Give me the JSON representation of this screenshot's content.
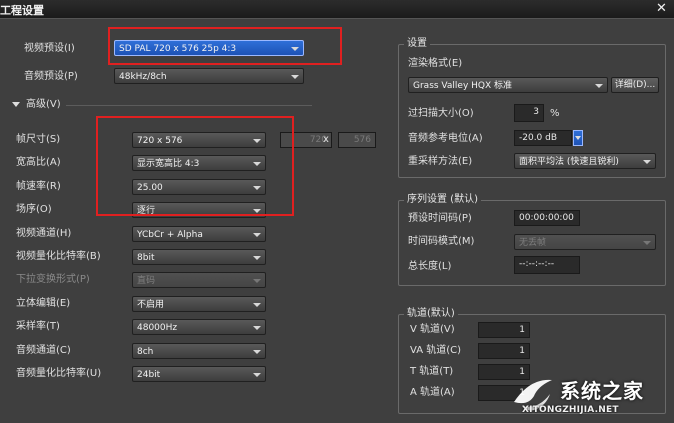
{
  "window": {
    "title": "工程设置",
    "close_glyph": "✕"
  },
  "left": {
    "video_preset": {
      "label": "视频预设(I)",
      "value": "SD PAL 720 x 576 25p 4:3"
    },
    "audio_preset": {
      "label": "音频预设(P)",
      "value": "48kHz/8ch"
    },
    "advanced_label": "高级(V)",
    "rows": [
      {
        "label": "帧尺寸(S)",
        "value": "720 x 576",
        "disabled": false
      },
      {
        "label": "宽高比(A)",
        "value": "显示宽高比 4:3",
        "disabled": false
      },
      {
        "label": "帧速率(R)",
        "value": "25.00",
        "disabled": false
      },
      {
        "label": "场序(O)",
        "value": "逐行",
        "disabled": false
      },
      {
        "label": "视频通道(H)",
        "value": "YCbCr + Alpha",
        "disabled": false
      },
      {
        "label": "视频量化比特率(B)",
        "value": "8bit",
        "disabled": false
      },
      {
        "label": "下拉变换形式(P)",
        "value": "直码",
        "disabled": true
      },
      {
        "label": "立体编辑(E)",
        "value": "不启用",
        "disabled": false
      },
      {
        "label": "采样率(T)",
        "value": "48000Hz",
        "disabled": false
      },
      {
        "label": "音频通道(C)",
        "value": "8ch",
        "disabled": false
      },
      {
        "label": "音频量化比特率(U)",
        "value": "24bit",
        "disabled": false
      }
    ],
    "frame_width": "720",
    "frame_x": "x",
    "frame_height": "576"
  },
  "settings": {
    "group_title": "设置",
    "render_format_label": "渲染格式(E)",
    "render_format_value": "Grass Valley HQX 标准",
    "detail_button": "详细(D)...",
    "overscan_label": "过扫描大小(O)",
    "overscan_value": "3",
    "overscan_unit": "%",
    "audio_ref_label": "音频参考电位(A)",
    "audio_ref_value": "-20.0 dB",
    "resample_label": "重采样方法(E)",
    "resample_value": "面积平均法 (快速且锐利)"
  },
  "sequence": {
    "group_title": "序列设置 (默认)",
    "preset_tc_label": "预设时间码(P)",
    "preset_tc_value": "00:00:00:00",
    "tc_mode_label": "时间码模式(M)",
    "tc_mode_value": "无丢帧",
    "total_length_label": "总长度(L)",
    "total_length_value": "--:--:--:--"
  },
  "tracks": {
    "group_title": "轨道(默认)",
    "items": [
      {
        "label": "V 轨道(V)",
        "value": "1"
      },
      {
        "label": "VA 轨道(C)",
        "value": "1"
      },
      {
        "label": "T 轨道(T)",
        "value": "1"
      },
      {
        "label": "A 轨道(A)",
        "value": "1"
      }
    ]
  },
  "watermark": {
    "brand": "系统之家",
    "url": "XITONGZHIJIA.NET"
  },
  "colors": {
    "highlight_red": "#e02020",
    "selected_blue": "#2f6fd8",
    "background": "#3f3f3f"
  }
}
